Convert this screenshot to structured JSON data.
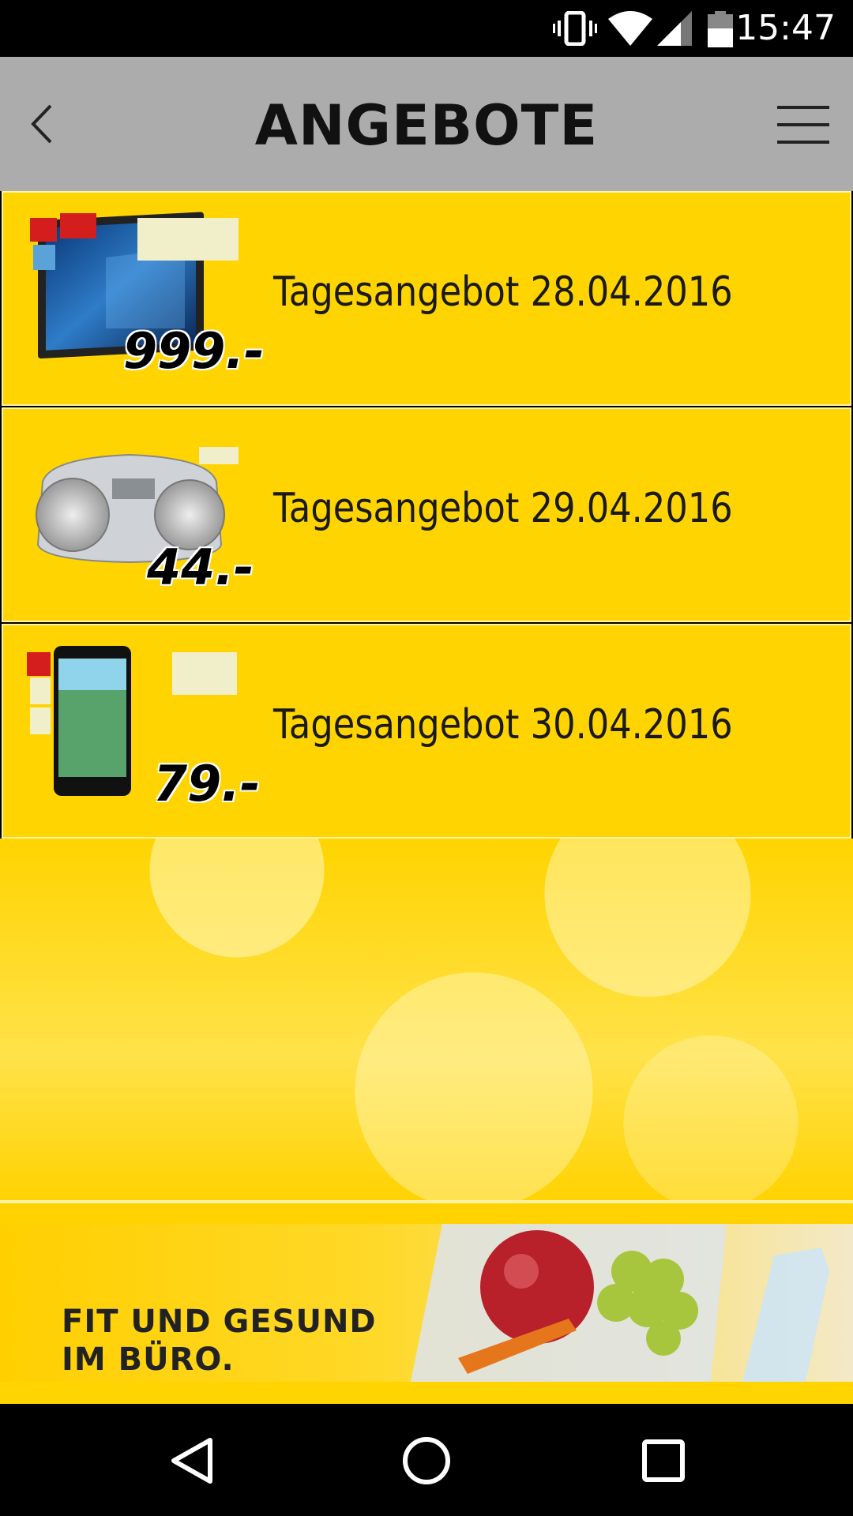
{
  "status_bar": {
    "time": "15:47",
    "icons": [
      "vibrate-icon",
      "wifi-icon",
      "signal-icon",
      "battery-icon"
    ]
  },
  "app_bar": {
    "title": "ANGEBOTE",
    "icons": [
      "back-chevron-icon",
      "hamburger-menu-icon"
    ]
  },
  "offers": [
    {
      "label": "Tagesangebot 28.04.2016",
      "price": "999.-",
      "product": "laptop-tablet"
    },
    {
      "label": "Tagesangebot 29.04.2016",
      "price": "44.-",
      "product": "cd-radio"
    },
    {
      "label": "Tagesangebot 30.04.2016",
      "price": "79.-",
      "product": "smartphone"
    }
  ],
  "banner": {
    "line1": "FIT UND GESUND",
    "line2": "IM BÜRO."
  },
  "nav_bar": {
    "icons": [
      "nav-back-icon",
      "nav-home-icon",
      "nav-recents-icon"
    ]
  },
  "colors": {
    "accent_yellow": "#ffd400",
    "app_bar_gray": "#acacac"
  }
}
